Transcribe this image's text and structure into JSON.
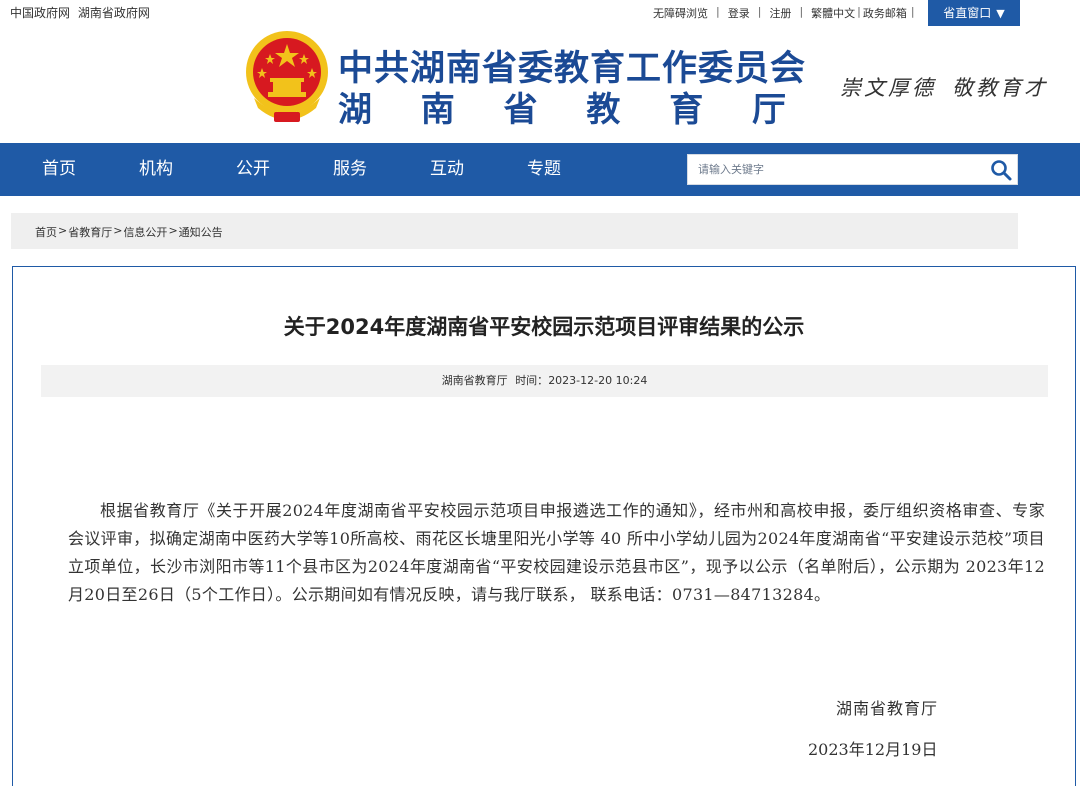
{
  "topbar": {
    "gov_links": [
      "中国政府网",
      "湖南省政府网"
    ],
    "util_links": [
      "无障碍浏览",
      "登录",
      "注册",
      "繁體中文",
      "政务邮箱"
    ],
    "province_window": "省直窗口"
  },
  "header": {
    "title_main": "中共湖南省委教育工作委员会",
    "title_sub": [
      "湖",
      "南",
      "省",
      "教",
      "育",
      "厅"
    ],
    "slogan": [
      "崇文厚德",
      "敬教育才"
    ]
  },
  "nav": {
    "items": [
      "首页",
      "机构",
      "公开",
      "服务",
      "互动",
      "专题"
    ]
  },
  "search": {
    "placeholder": "请输入关键字"
  },
  "breadcrumb": [
    "首页",
    "省教育厅",
    "信息公开",
    "通知公告"
  ],
  "article": {
    "title": "关于2024年度湖南省平安校园示范项目评审结果的公示",
    "source": "湖南省教育厅",
    "time_label": "时间：",
    "time": "2023-12-20 10:24",
    "body": "根据省教育厅《关于开展2024年度湖南省平安校园示范项目申报遴选工作的通知》，经市州和高校申报，委厅组织资格审查、专家会议评审，拟确定湖南中医药大学等10所高校、雨花区长塘里阳光小学等 40 所中小学幼儿园为2024年度湖南省“平安建设示范校”项目立项单位，长沙市浏阳市等11个县市区为2024年度湖南省“平安校园建设示范县市区”，现予以公示（名单附后），公示期为 2023年12月20日至26日（5个工作日）。公示期间如有情况反映，请与我厅联系， 联系电话：0731—84713284。",
    "sign_org": "湖南省教育厅",
    "sign_date": "2023年12月19日"
  },
  "colors": {
    "brand_blue": "#1f5aa6",
    "title_blue": "#1b4a95",
    "emblem_red": "#d71920",
    "emblem_gold": "#f2c21b"
  }
}
